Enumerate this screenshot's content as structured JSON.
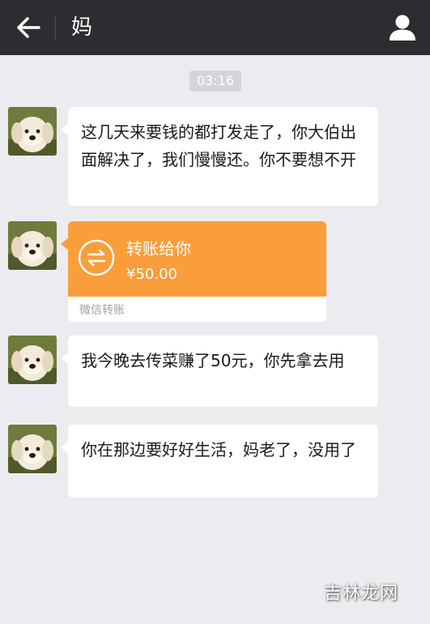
{
  "header": {
    "title": "妈",
    "back_icon": "back-arrow-icon",
    "profile_icon": "person-icon"
  },
  "chat": {
    "timestamp": "03:16",
    "messages": [
      {
        "type": "text",
        "text": "这几天来要钱的都打发走了，你大伯出面解决了，我们慢慢还。你不要想不开"
      },
      {
        "type": "transfer",
        "title": "转账给你",
        "amount": "¥50.00",
        "footer": "微信转账"
      },
      {
        "type": "text",
        "text": "我今晚去传菜赚了50元，你先拿去用"
      },
      {
        "type": "text",
        "text": "你在那边要好好生活，妈老了，没用了"
      }
    ]
  },
  "watermark": "吉林龙网",
  "colors": {
    "title_bar": "#2c2d31",
    "chat_background": "#ececf0",
    "transfer_orange": "#fa9d3b",
    "bubble": "#ffffff"
  }
}
